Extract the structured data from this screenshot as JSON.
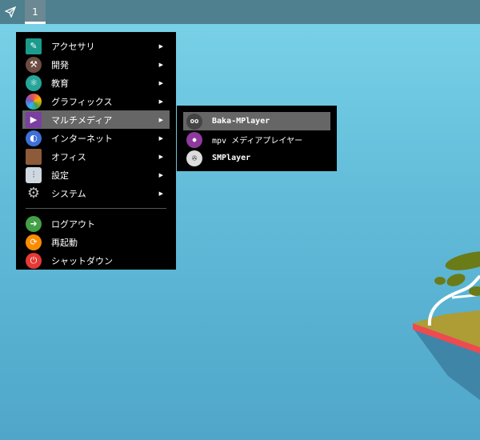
{
  "taskbar": {
    "workspace": "1"
  },
  "menu": {
    "items": [
      {
        "label": "アクセサリ",
        "icon": "accessories-icon",
        "color": "#1a9b8c"
      },
      {
        "label": "開発",
        "icon": "development-icon",
        "color": "#6d4c41"
      },
      {
        "label": "教育",
        "icon": "education-icon",
        "color": "#26a69a"
      },
      {
        "label": "グラフィックス",
        "icon": "graphics-icon",
        "color": "#ef5350"
      },
      {
        "label": "マルチメディア",
        "icon": "multimedia-icon",
        "color": "#7b3fa0"
      },
      {
        "label": "インターネット",
        "icon": "internet-icon",
        "color": "#3f6fd8"
      },
      {
        "label": "オフィス",
        "icon": "office-icon",
        "color": "#8d5a3a"
      },
      {
        "label": "設定",
        "icon": "settings-icon",
        "color": "#cfd8e0"
      },
      {
        "label": "システム",
        "icon": "system-icon",
        "color": "#444"
      }
    ],
    "session": [
      {
        "label": "ログアウト",
        "icon": "logout-icon",
        "color": "#43a047"
      },
      {
        "label": "再起動",
        "icon": "reboot-icon",
        "color": "#fb8c00"
      },
      {
        "label": "シャットダウン",
        "icon": "shutdown-icon",
        "color": "#e53935"
      }
    ]
  },
  "submenu": {
    "items": [
      {
        "label": "Baka-MPlayer",
        "color": "#444"
      },
      {
        "label": "mpv メディアプレイヤー",
        "color": "#8e3a9d"
      },
      {
        "label": "SMPlayer",
        "color": "#ddd"
      }
    ]
  }
}
